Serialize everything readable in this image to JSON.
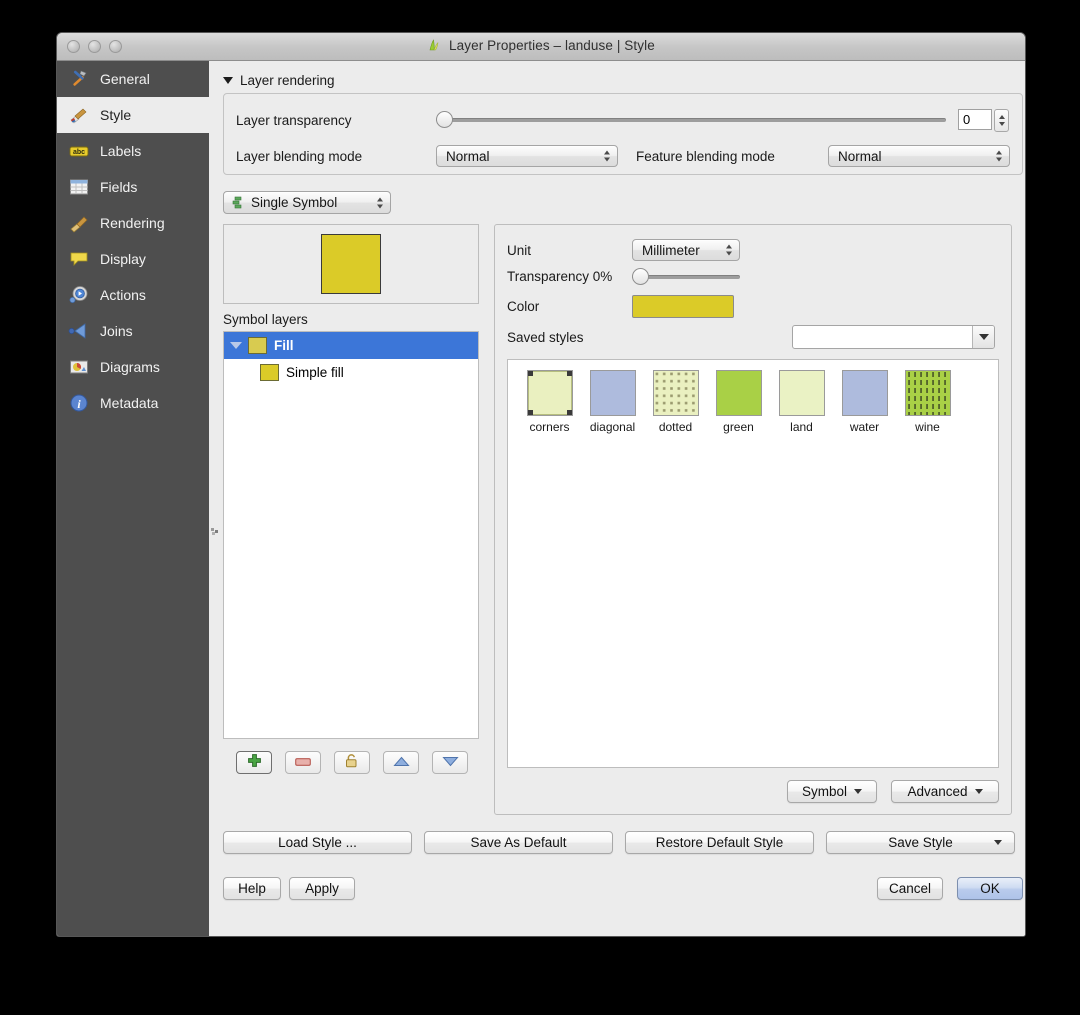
{
  "window": {
    "title": "Layer Properties – landuse | Style",
    "title_icon": "qgis-layer-icon",
    "traffic_lights": [
      "close-button",
      "minimize-button",
      "zoom-button"
    ]
  },
  "sidebar": {
    "items": [
      {
        "label": "General",
        "icon": "tools-icon",
        "selected": false
      },
      {
        "label": "Style",
        "icon": "brush-icon",
        "selected": true
      },
      {
        "label": "Labels",
        "icon": "abc-label-icon",
        "selected": false
      },
      {
        "label": "Fields",
        "icon": "table-icon",
        "selected": false
      },
      {
        "label": "Rendering",
        "icon": "broom-icon",
        "selected": false
      },
      {
        "label": "Display",
        "icon": "speech-bubble-icon",
        "selected": false
      },
      {
        "label": "Actions",
        "icon": "gear-play-icon",
        "selected": false
      },
      {
        "label": "Joins",
        "icon": "join-arrow-icon",
        "selected": false
      },
      {
        "label": "Diagrams",
        "icon": "chart-image-icon",
        "selected": false
      },
      {
        "label": "Metadata",
        "icon": "info-icon",
        "selected": false
      }
    ]
  },
  "layer_rendering": {
    "section_title": "Layer rendering",
    "transparency_label": "Layer transparency",
    "transparency_value": "0",
    "transparency_percent": 0,
    "blending_label": "Layer blending mode",
    "blending_value": "Normal",
    "feature_blending_label": "Feature blending mode",
    "feature_blending_value": "Normal"
  },
  "renderer": {
    "selected": "Single Symbol",
    "icon": "single-symbol-icon"
  },
  "symbol": {
    "preview_color": "#dbcb28",
    "symbol_layers_label": "Symbol layers",
    "tree": [
      {
        "label": "Fill",
        "color": "#d8cb50",
        "selected": true,
        "level": 0
      },
      {
        "label": "Simple fill",
        "color": "#dbcb28",
        "selected": false,
        "level": 1
      }
    ],
    "toolbar": [
      {
        "name": "add-symbol-layer-button",
        "icon": "plus-icon",
        "focused": true
      },
      {
        "name": "remove-symbol-layer-button",
        "icon": "minus-icon",
        "focused": false
      },
      {
        "name": "lock-colors-button",
        "icon": "lock-icon",
        "focused": false
      },
      {
        "name": "move-up-button",
        "icon": "arrow-up-icon",
        "focused": false
      },
      {
        "name": "move-down-button",
        "icon": "arrow-down-icon",
        "focused": false
      }
    ]
  },
  "properties": {
    "unit_label": "Unit",
    "unit_value": "Millimeter",
    "transparency_label": "Transparency 0%",
    "transparency_percent": 0,
    "color_label": "Color",
    "color_value": "#dbcb28",
    "saved_styles_label": "Saved styles",
    "saved_styles_value": "",
    "saved_styles_placeholder": ""
  },
  "saved_styles": [
    {
      "name": "corners",
      "fill": "#eaf0c0",
      "pattern": "corner-marks"
    },
    {
      "name": "diagonal",
      "fill": "#aebbdd",
      "pattern": "solid"
    },
    {
      "name": "dotted",
      "fill": "#eaf0c0",
      "pattern": "dots"
    },
    {
      "name": "green",
      "fill": "#a9d046",
      "pattern": "solid"
    },
    {
      "name": "land",
      "fill": "#eaf2c4",
      "pattern": "solid"
    },
    {
      "name": "water",
      "fill": "#aebbdd",
      "pattern": "solid"
    },
    {
      "name": "wine",
      "fill": "#a9d046",
      "pattern": "dashes"
    }
  ],
  "style_buttons": {
    "symbol": "Symbol",
    "advanced": "Advanced"
  },
  "dialog_buttons": {
    "load_style": "Load Style ...",
    "save_as_default": "Save As Default",
    "restore_default_style": "Restore Default Style",
    "save_style": "Save Style",
    "help": "Help",
    "apply": "Apply",
    "cancel": "Cancel",
    "ok": "OK"
  }
}
